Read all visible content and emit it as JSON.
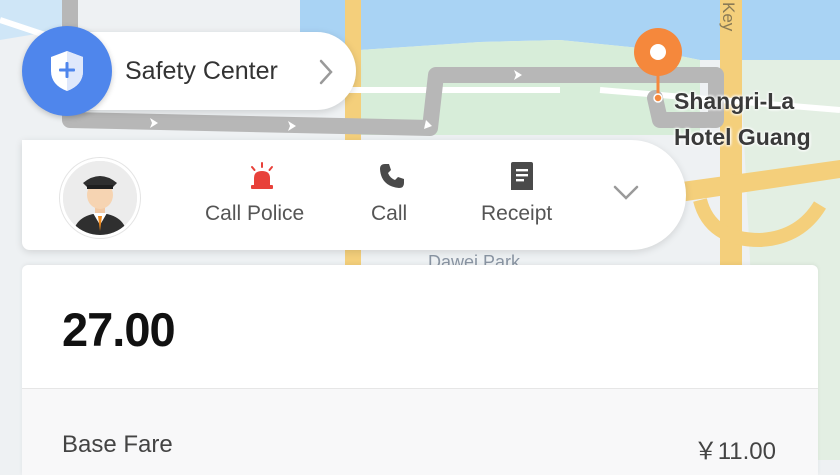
{
  "map": {
    "destination_name_line1": "Shangri-La",
    "destination_name_line2": "Hotel Guang",
    "park_label": "Dawei Park",
    "road_label": "Key",
    "colors": {
      "water": "#a9d3f4",
      "route": "#b7b7b7",
      "pin": "#f5883c",
      "road": "#f4cf7b"
    }
  },
  "safety": {
    "label": "Safety Center",
    "icon": "shield-plus-icon"
  },
  "driver_card": {
    "avatar_icon": "driver-avatar",
    "actions": [
      {
        "label": "Call Police",
        "icon": "siren-icon",
        "color": "#e8413a"
      },
      {
        "label": "Call",
        "icon": "phone-icon",
        "color": "#4a4a4a"
      },
      {
        "label": "Receipt",
        "icon": "receipt-icon",
        "color": "#4a4a4a"
      }
    ],
    "collapse_icon": "chevron-down-icon"
  },
  "fare": {
    "total": "27.00",
    "base_fare_label": "Base Fare",
    "base_fare_value": "￥11.00"
  }
}
